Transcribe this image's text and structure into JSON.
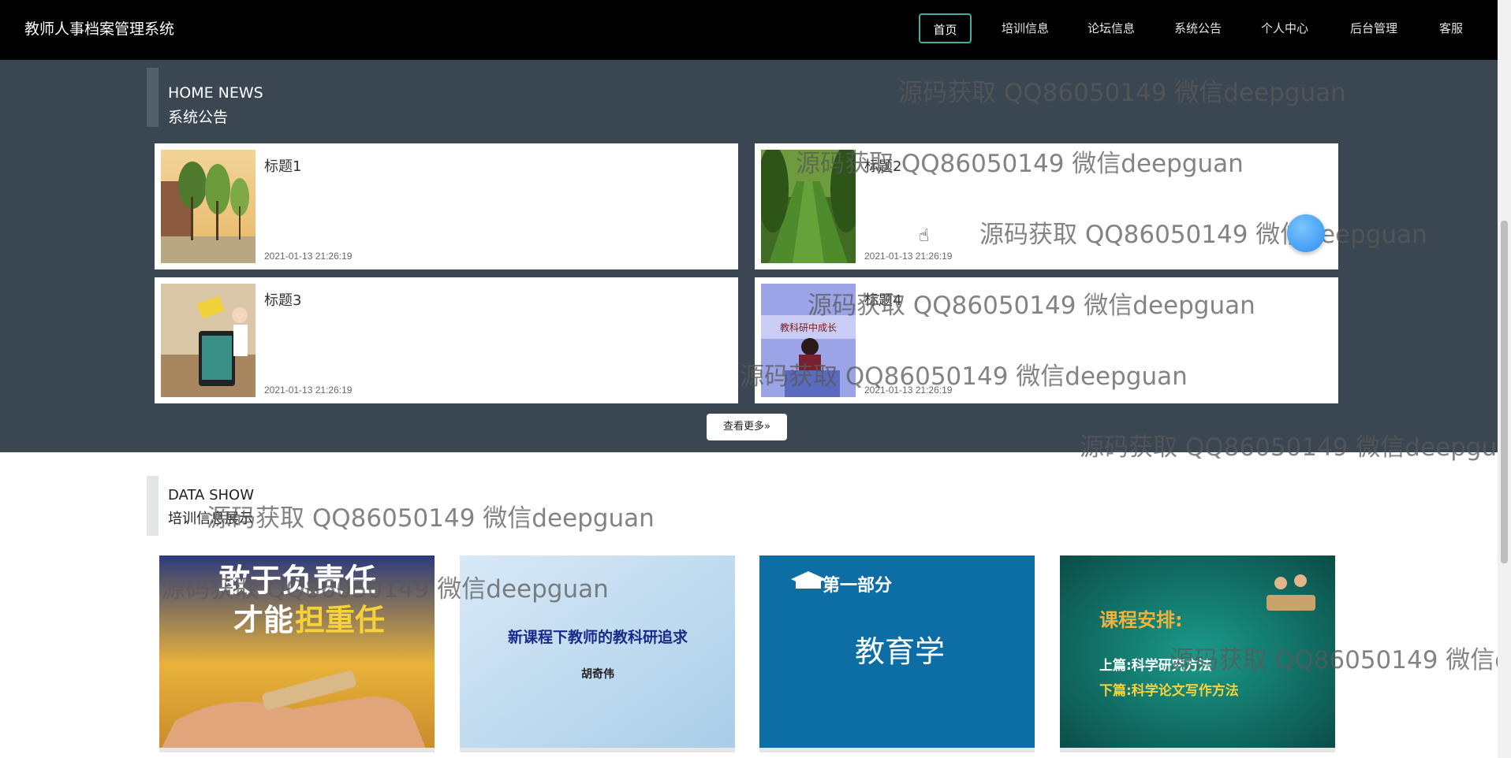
{
  "app": {
    "title": "教师人事档案管理系统"
  },
  "nav": {
    "items": [
      {
        "label": "首页",
        "active": true
      },
      {
        "label": "培训信息"
      },
      {
        "label": "论坛信息"
      },
      {
        "label": "系统公告"
      },
      {
        "label": "个人中心"
      },
      {
        "label": "后台管理"
      },
      {
        "label": "客服"
      }
    ]
  },
  "news_section": {
    "en": "HOME NEWS",
    "cn": "系统公告",
    "items": [
      {
        "title": "标题1",
        "date": "2021-01-13 21:26:19"
      },
      {
        "title": "标题2",
        "date": "2021-01-13 21:26:19"
      },
      {
        "title": "标题3",
        "date": "2021-01-13 21:26:19"
      },
      {
        "title": "标题4",
        "date": "2021-01-13 21:26:19"
      }
    ],
    "more_label": "查看更多»"
  },
  "show_section": {
    "en": "DATA SHOW",
    "cn": "培训信息展示",
    "cards": [
      {
        "line1": "敢于负责任",
        "line2a": "才能",
        "line2b": "担重任"
      },
      {
        "line1": "新课程下教师的教科研追求",
        "line2": "胡奇伟"
      },
      {
        "header": "第一部分",
        "body": "教育学"
      },
      {
        "header": "课程安排:",
        "line1": "上篇:科学研究方法",
        "line2": "下篇:科学论文写作方法"
      }
    ]
  },
  "thumb4_text": "教科研中成长",
  "watermark": "源码获取 QQ86050149 微信deepguan",
  "colors": {
    "nav_bg": "#000000",
    "section_bg": "#3a4651",
    "active_border": "#3fae9a"
  }
}
